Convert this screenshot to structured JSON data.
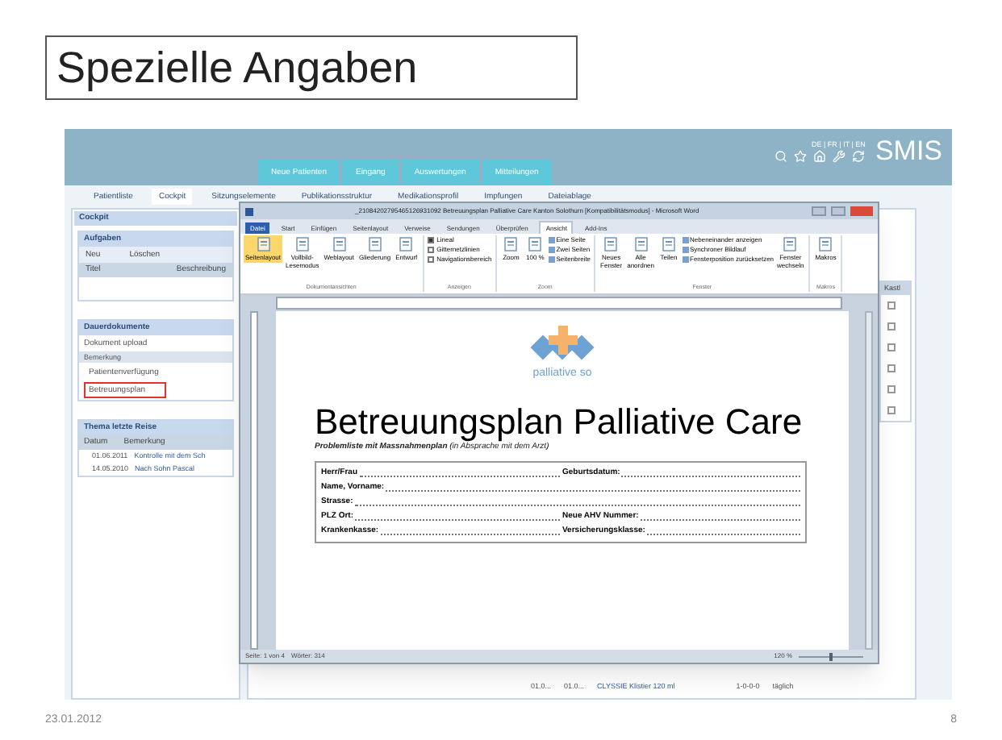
{
  "slide": {
    "title": "Spezielle Angaben",
    "date": "23.01.2012",
    "page_number": "8"
  },
  "app": {
    "languages": "DE | FR | IT | EN",
    "logo": "SMIS",
    "top_tabs": [
      "Neue Patienten",
      "Eingang",
      "Auswertungen",
      "Mitteilungen"
    ],
    "nav_tabs": [
      {
        "label": "Patientliste",
        "selected": false
      },
      {
        "label": "Cockpit",
        "selected": true
      },
      {
        "label": "Sitzungselemente",
        "selected": false
      },
      {
        "label": "Publikationsstruktur",
        "selected": false
      },
      {
        "label": "Medikationsprofil",
        "selected": false
      },
      {
        "label": "Impfungen",
        "selected": false
      },
      {
        "label": "Dateiablage",
        "selected": false
      }
    ],
    "cockpit_title": "Cockpit",
    "tasks": {
      "title": "Aufgaben",
      "actions": [
        "Neu",
        "Löschen"
      ],
      "columns": [
        "Titel",
        "Beschreibung"
      ]
    },
    "documents": {
      "title": "Dauerdokumente",
      "upload": "Dokument upload",
      "column": "Bemerkung",
      "items": [
        {
          "label": "Patientenverfügung",
          "highlighted": false
        },
        {
          "label": "Betreuungsplan",
          "highlighted": true
        }
      ]
    },
    "recent": {
      "title": "Thema letzte Reise",
      "columns": [
        "Datum",
        "Bemerkung"
      ],
      "rows": [
        {
          "date": "01.06.2011",
          "note": "Kontrolle mit dem Sch"
        },
        {
          "date": "14.05.2010",
          "note": "Nach Sohn Pascal"
        }
      ]
    },
    "right_panel": {
      "column": "Kastl",
      "checkboxes": [
        {
          "checked": false
        },
        {
          "checked": false
        },
        {
          "checked": false
        },
        {
          "checked": false
        },
        {
          "checked": false
        },
        {
          "checked": false
        }
      ]
    },
    "medication_row": [
      "01.0...",
      "01.0...",
      "CLYSSIE Klistier 120 ml",
      "1-0-0-0",
      "täglich"
    ]
  },
  "word": {
    "title": "_21084202795465126931092 Betreuungsplan Palliative Care Kanton Solothurn [Kompatibilitätsmodus] - Microsoft Word",
    "ribbon_tabs": [
      {
        "label": "Datei",
        "selected": false,
        "kind": "file"
      },
      {
        "label": "Start",
        "selected": false,
        "kind": "tab"
      },
      {
        "label": "Einfügen",
        "selected": false,
        "kind": "tab"
      },
      {
        "label": "Seitenlayout",
        "selected": false,
        "kind": "tab"
      },
      {
        "label": "Verweise",
        "selected": false,
        "kind": "tab"
      },
      {
        "label": "Sendungen",
        "selected": false,
        "kind": "tab"
      },
      {
        "label": "Überprüfen",
        "selected": false,
        "kind": "tab"
      },
      {
        "label": "Ansicht",
        "selected": true,
        "kind": "tab"
      },
      {
        "label": "Add-Ins",
        "selected": false,
        "kind": "tab"
      }
    ],
    "ribbon_groups": [
      {
        "name": "Dokumentansichten",
        "items": [
          {
            "kind": "big",
            "label": "Seitenlayout",
            "selected": true
          },
          {
            "kind": "big",
            "label": "Vollbild-Lesemodus",
            "selected": false
          },
          {
            "kind": "big",
            "label": "Weblayout",
            "selected": false
          },
          {
            "kind": "big",
            "label": "Gliederung",
            "selected": false
          },
          {
            "kind": "big",
            "label": "Entwurf",
            "selected": false
          }
        ]
      },
      {
        "name": "Anzeigen",
        "items": [
          {
            "kind": "check",
            "label": "Lineal",
            "checked": true
          },
          {
            "kind": "check",
            "label": "Gitternetzlinien",
            "checked": false
          },
          {
            "kind": "check",
            "label": "Navigationsbereich",
            "checked": false
          }
        ]
      },
      {
        "name": "Zoom",
        "items": [
          {
            "kind": "big",
            "label": "Zoom",
            "selected": false
          },
          {
            "kind": "big",
            "label": "100 %",
            "selected": false
          },
          {
            "kind": "small",
            "label": "Eine Seite"
          },
          {
            "kind": "small",
            "label": "Zwei Seiten"
          },
          {
            "kind": "small",
            "label": "Seitenbreite"
          }
        ]
      },
      {
        "name": "Fenster",
        "items": [
          {
            "kind": "big",
            "label": "Neues Fenster",
            "selected": false
          },
          {
            "kind": "big",
            "label": "Alle anordnen",
            "selected": false
          },
          {
            "kind": "big",
            "label": "Teilen",
            "selected": false
          },
          {
            "kind": "small",
            "label": "Nebeneinander anzeigen"
          },
          {
            "kind": "small",
            "label": "Synchroner Bildlauf"
          },
          {
            "kind": "small",
            "label": "Fensterposition zurücksetzen"
          },
          {
            "kind": "big",
            "label": "Fenster wechseln",
            "selected": false
          }
        ]
      },
      {
        "name": "Makros",
        "items": [
          {
            "kind": "big",
            "label": "Makros",
            "selected": false
          }
        ]
      }
    ],
    "document": {
      "logo_text": "palliative so",
      "heading": "Betreuungsplan Palliative Care",
      "subtitle": "**Problemliste mit Massnahmenplan** (in Absprache mit dem Arzt)",
      "form_rows": [
        [
          "Herr/Frau",
          "Geburtsdatum:"
        ],
        [
          "Name, Vorname:"
        ],
        [
          "Strasse:"
        ],
        [
          "PLZ Ort:",
          "Neue AHV Nummer:"
        ],
        [
          "Krankenkasse:",
          "Versicherungsklasse:"
        ]
      ]
    },
    "status": {
      "page": "Seite: 1 von 4",
      "words": "Wörter: 314",
      "zoom": "120 %",
      "zoom_slider": {
        "level": 0.5
      }
    }
  }
}
